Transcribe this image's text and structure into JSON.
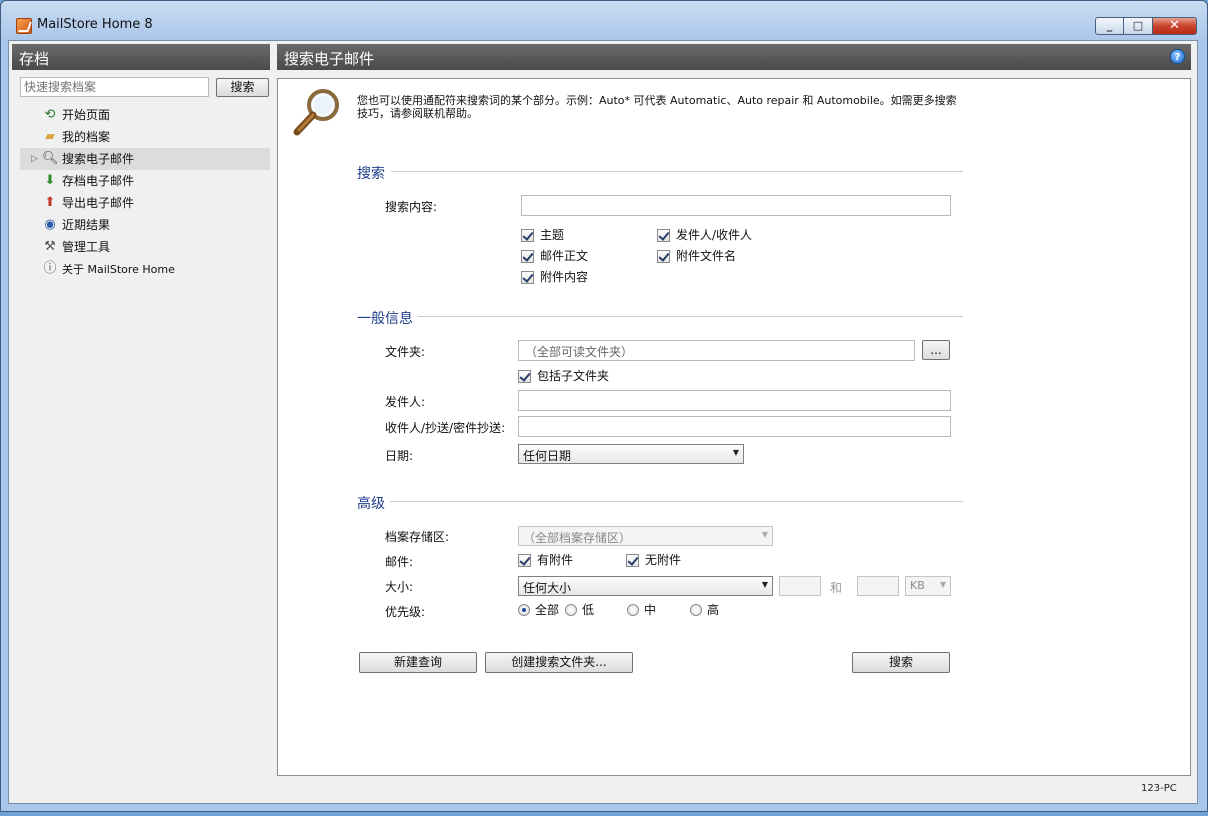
{
  "window": {
    "title": "MailStore Home 8"
  },
  "left": {
    "header": "存档",
    "search_placeholder": "快速搜索档案",
    "search_button": "搜索",
    "nav": [
      {
        "label": "开始页面",
        "icon": "start-page-icon"
      },
      {
        "label": "我的档案",
        "icon": "folder-icon"
      },
      {
        "label": "搜索电子邮件",
        "icon": "magnifier-icon",
        "selected": true
      },
      {
        "label": "存档电子邮件",
        "icon": "archive-email-icon"
      },
      {
        "label": "导出电子邮件",
        "icon": "export-email-icon"
      },
      {
        "label": "近期结果",
        "icon": "recent-results-icon"
      },
      {
        "label": "管理工具",
        "icon": "admin-tools-icon"
      },
      {
        "label": "关于 MailStore Home",
        "icon": "info-icon"
      }
    ]
  },
  "right": {
    "header": "搜索电子邮件",
    "intro": "您也可以使用通配符来搜索词的某个部分。示例：Auto* 可代表 Automatic、Auto repair 和 Automobile。如需更多搜索技巧，请参阅联机帮助。",
    "search_section": {
      "title": "搜索",
      "content_label": "搜索内容:",
      "checks": [
        "主题",
        "发件人/收件人",
        "邮件正文",
        "附件文件名",
        "附件内容"
      ]
    },
    "general_section": {
      "title": "一般信息",
      "folder_label": "文件夹:",
      "folder_value": "（全部可读文件夹）",
      "browse_button": "...",
      "include_subfolders": "包括子文件夹",
      "from_label": "发件人:",
      "to_label": "收件人/抄送/密件抄送:",
      "date_label": "日期:",
      "date_value": "任何日期"
    },
    "advanced_section": {
      "title": "高级",
      "store_label": "档案存储区:",
      "store_value": "（全部档案存储区）",
      "mail_label": "邮件:",
      "has_attachment": "有附件",
      "no_attachment": "无附件",
      "size_label": "大小:",
      "size_value": "任何大小",
      "and_label": "和",
      "unit_value": "KB",
      "priority_label": "优先级:",
      "priority_options": [
        "全部",
        "低",
        "中",
        "高"
      ]
    },
    "buttons": {
      "new_query": "新建查询",
      "create_folder": "创建搜索文件夹...",
      "search": "搜索"
    }
  },
  "status": {
    "computer": "123-PC"
  }
}
